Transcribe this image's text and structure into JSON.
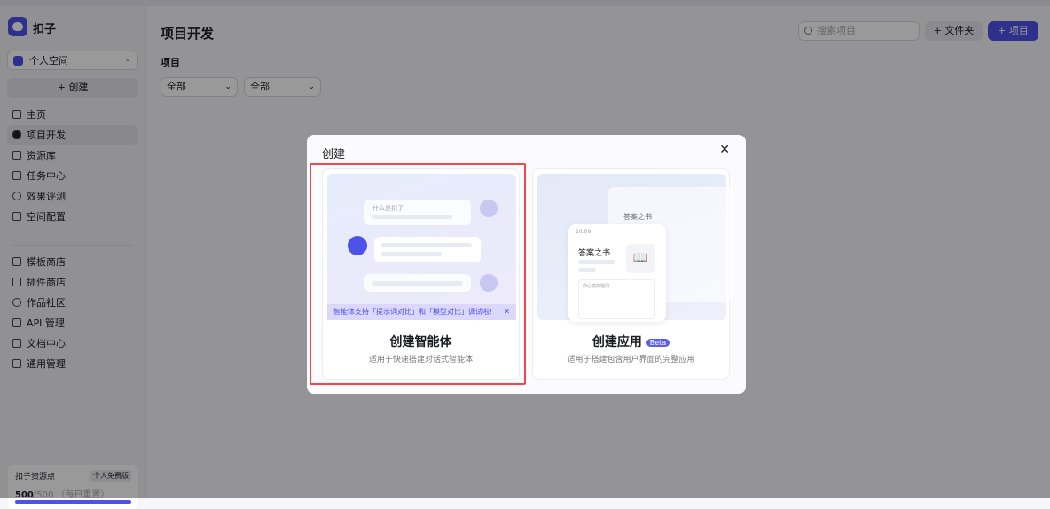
{
  "sidebar": {
    "brand": "扣子",
    "space": "个人空间",
    "create": "+ 创建",
    "nav": [
      {
        "label": "主页"
      },
      {
        "label": "项目开发"
      },
      {
        "label": "资源库"
      },
      {
        "label": "任务中心"
      },
      {
        "label": "效果评测"
      },
      {
        "label": "空间配置"
      }
    ],
    "nav2": [
      {
        "label": "模板商店"
      },
      {
        "label": "插件商店"
      },
      {
        "label": "作品社区"
      },
      {
        "label": "API 管理"
      },
      {
        "label": "文档中心"
      },
      {
        "label": "通用管理"
      }
    ],
    "resource": {
      "title": "扣子资源点",
      "badge": "个人免费版",
      "used": "500",
      "total": "/500",
      "note": "（每日重置）",
      "progress": 1.0
    }
  },
  "main": {
    "title": "项目开发",
    "subtitle": "项目",
    "filter1": "全部",
    "filter2": "全部",
    "search_placeholder": "搜索项目",
    "folder_btn": "+ 文件夹",
    "project_btn": "+ 项目"
  },
  "modal": {
    "title": "创建",
    "close": "✕",
    "agent": {
      "title": "创建智能体",
      "desc": "适用于快速搭建对话式智能体",
      "banner": "智能体支持「提示词对比」和「模型对比」调试啦!",
      "banner_close": "✕",
      "chat_q": "什么是扣子"
    },
    "app": {
      "title": "创建应用",
      "badge": "Beta",
      "desc": "适用于搭建包含用户界面的完整应用",
      "app_name": "答案之书",
      "time": "10:09",
      "input_hint": "你心底的疑问",
      "book": "📖"
    }
  }
}
